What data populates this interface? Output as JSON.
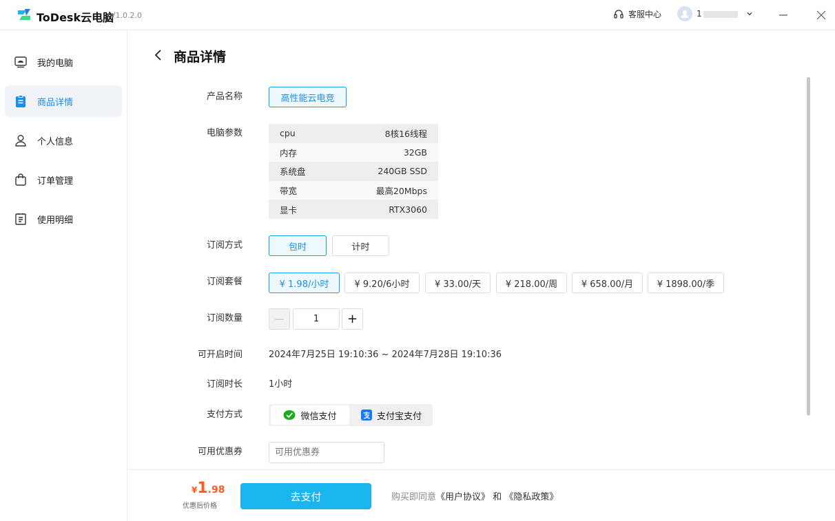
{
  "app": {
    "name": "ToDesk云电脑",
    "version": "V1.0.2.0",
    "support_label": "客服中心",
    "user_name": "1"
  },
  "sidebar": {
    "items": [
      {
        "label": "我的电脑",
        "icon": "monitor-icon"
      },
      {
        "label": "商品详情",
        "icon": "clipboard-icon",
        "active": true
      },
      {
        "label": "个人信息",
        "icon": "user-icon"
      },
      {
        "label": "订单管理",
        "icon": "bag-icon"
      },
      {
        "label": "使用明细",
        "icon": "list-icon"
      }
    ]
  },
  "page": {
    "title": "商品详情"
  },
  "labels": {
    "product_name": "产品名称",
    "specs": "电脑参数",
    "subscription_type": "订阅方式",
    "plan": "订阅套餐",
    "quantity": "订阅数量",
    "available_time": "可开启时间",
    "duration": "订阅时长",
    "payment_method": "支付方式",
    "coupon": "可用优惠券"
  },
  "product": {
    "name": "高性能云电竞"
  },
  "specs": [
    {
      "key": "cpu",
      "value": "8核16线程"
    },
    {
      "key": "内存",
      "value": "32GB"
    },
    {
      "key": "系统盘",
      "value": "240GB SSD"
    },
    {
      "key": "带宽",
      "value": "最高20Mbps"
    },
    {
      "key": "显卡",
      "value": "RTX3060"
    }
  ],
  "subscription_types": [
    {
      "label": "包时",
      "selected": true
    },
    {
      "label": "计时",
      "selected": false
    }
  ],
  "plans": [
    {
      "label": "¥ 1.98/小时",
      "selected": true
    },
    {
      "label": "¥ 9.20/6小时",
      "selected": false
    },
    {
      "label": "¥ 33.00/天",
      "selected": false
    },
    {
      "label": "¥ 218.00/周",
      "selected": false
    },
    {
      "label": "¥ 658.00/月",
      "selected": false
    },
    {
      "label": "¥ 1898.00/季",
      "selected": false
    }
  ],
  "quantity": {
    "minus": "—",
    "value": "1",
    "plus": "+"
  },
  "available_time": "2024年7月25日 19:10:36 ~ 2024年7月28日 19:10:36",
  "duration": "1小时",
  "payment": {
    "wechat": "微信支付",
    "alipay": "支付宝支付",
    "selected": "wechat"
  },
  "coupon": {
    "placeholder": "可用优惠券"
  },
  "footer": {
    "currency": "¥",
    "price_int": "1",
    "price_dec": ".98",
    "price_note": "优惠后价格",
    "pay_button": "去支付",
    "agree_prefix": "购买即同意",
    "user_agreement": "《用户协议》",
    "and": "和",
    "privacy_policy": "《隐私政策》"
  },
  "colors": {
    "accent": "#1a9be8",
    "pay_button": "#1ab4ee",
    "price": "#ff5a1f",
    "wechat": "#1aad19",
    "alipay": "#1677ff"
  }
}
